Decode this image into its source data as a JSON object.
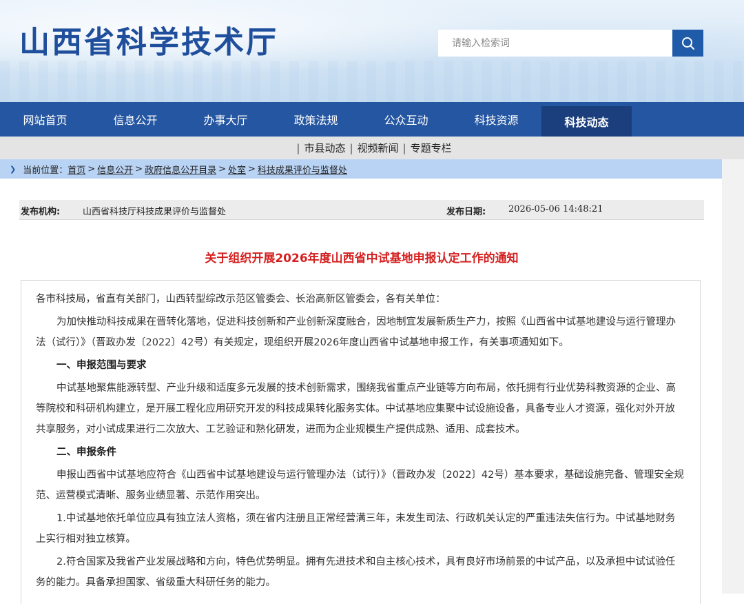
{
  "header": {
    "site_title": "山西省科学技术厅",
    "search_placeholder": "请输入检索词"
  },
  "main_nav": [
    {
      "label": "网站首页"
    },
    {
      "label": "信息公开"
    },
    {
      "label": "办事大厅"
    },
    {
      "label": "政策法规"
    },
    {
      "label": "公众互动"
    },
    {
      "label": "科技资源"
    },
    {
      "label": "科技动态",
      "active": true
    }
  ],
  "sub_nav": [
    {
      "label": "市县动态"
    },
    {
      "label": "视频新闻"
    },
    {
      "label": "专题专栏"
    }
  ],
  "breadcrumb": {
    "prefix": "当前位置：",
    "items": [
      "首页",
      "信息公开",
      "政府信息公开目录",
      "处室",
      "科技成果评价与监督处"
    ]
  },
  "meta": {
    "publisher_label": "发布机构:",
    "publisher": "山西省科技厅科技成果评价与监督处",
    "date_label": "发布日期:",
    "date": "2026-05-06 14:48:21"
  },
  "article": {
    "title": "关于组织开展2026年度山西省中试基地申报认定工作的通知",
    "paragraphs": [
      {
        "style": "plain",
        "text": "各市科技局，省直有关部门，山西转型综改示范区管委会、长治高新区管委会，各有关单位："
      },
      {
        "style": "indent",
        "text": "为加快推动科技成果在晋转化落地，促进科技创新和产业创新深度融合，因地制宜发展新质生产力，按照《山西省中试基地建设与运行管理办法（试行）》（晋政办发〔2022〕42号）有关规定，现组织开展2026年度山西省中试基地申报工作，有关事项通知如下。"
      },
      {
        "style": "heading",
        "text": "一、申报范围与要求"
      },
      {
        "style": "indent",
        "text": "中试基地聚焦能源转型、产业升级和适度多元发展的技术创新需求，围绕我省重点产业链等方向布局，依托拥有行业优势科教资源的企业、高等院校和科研机构建立，是开展工程化应用研究开发的科技成果转化服务实体。中试基地应集聚中试设施设备，具备专业人才资源，强化对外开放共享服务，对小试成果进行二次放大、工艺验证和熟化研发，进而为企业规模生产提供成熟、适用、成套技术。"
      },
      {
        "style": "heading",
        "text": "二、申报条件"
      },
      {
        "style": "indent",
        "text": "申报山西省中试基地应符合《山西省中试基地建设与运行管理办法（试行）》（晋政办发〔2022〕42号）基本要求，基础设施完备、管理安全规范、运营模式清晰、服务业绩显著、示范作用突出。"
      },
      {
        "style": "indent",
        "text": "1.中试基地依托单位应具有独立法人资格，须在省内注册且正常经营满三年，未发生司法、行政机关认定的严重违法失信行为。中试基地财务上实行相对独立核算。"
      },
      {
        "style": "indent",
        "text": "2.符合国家及我省产业发展战略和方向，特色优势明显。拥有先进技术和自主核心技术，具有良好市场前景的中试产品，以及承担中试试验任务的能力。具备承担国家、省级重大科研任务的能力。"
      }
    ]
  }
}
